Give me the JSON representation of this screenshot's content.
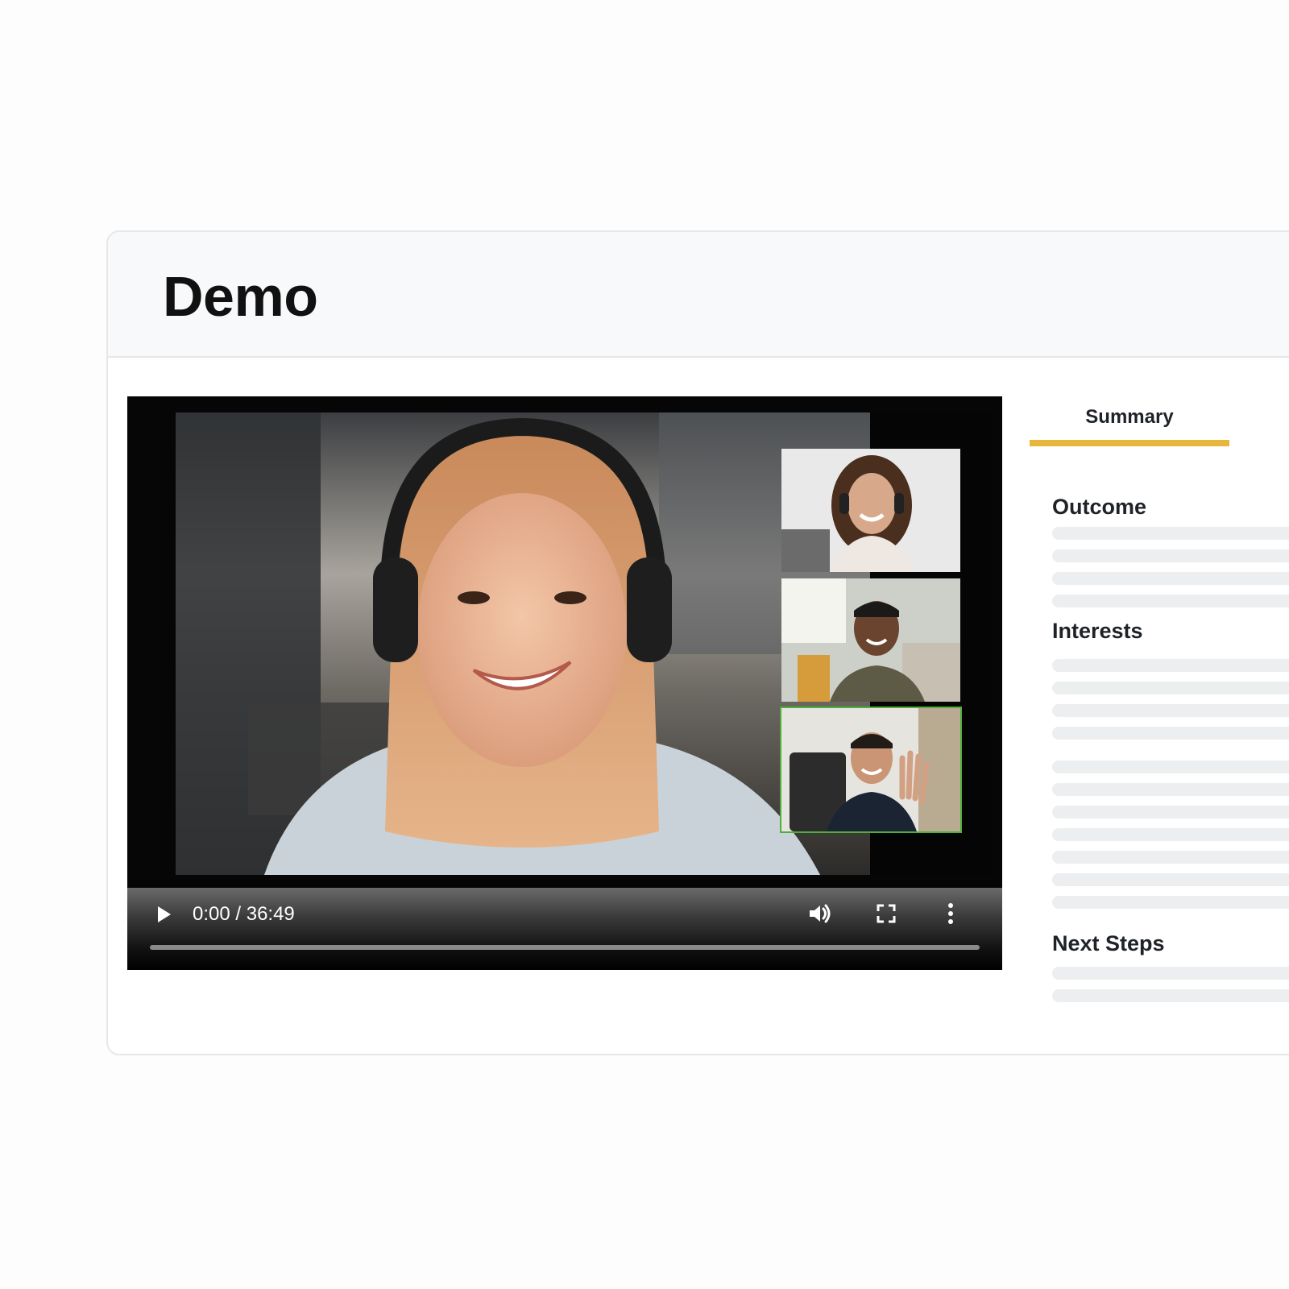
{
  "page": {
    "title": "Demo"
  },
  "player": {
    "time_display": "0:00 / 36:49",
    "progress": 0,
    "controls": {
      "play_icon": "play-icon",
      "volume_icon": "volume-icon",
      "fullscreen_icon": "fullscreen-icon",
      "more_icon": "more-vertical-icon"
    },
    "participants": [
      {
        "role": "speaker",
        "active": false
      },
      {
        "role": "participant",
        "active": false
      },
      {
        "role": "participant",
        "active": false
      },
      {
        "role": "participant",
        "active": true
      }
    ],
    "active_speaker_color": "#4fae3c"
  },
  "summary_panel": {
    "tab_label": "Summary",
    "accent_color": "#e7b73c",
    "sections": [
      {
        "heading": "Outcome"
      },
      {
        "heading": "Interests"
      },
      {
        "heading": "Next Steps"
      }
    ]
  }
}
